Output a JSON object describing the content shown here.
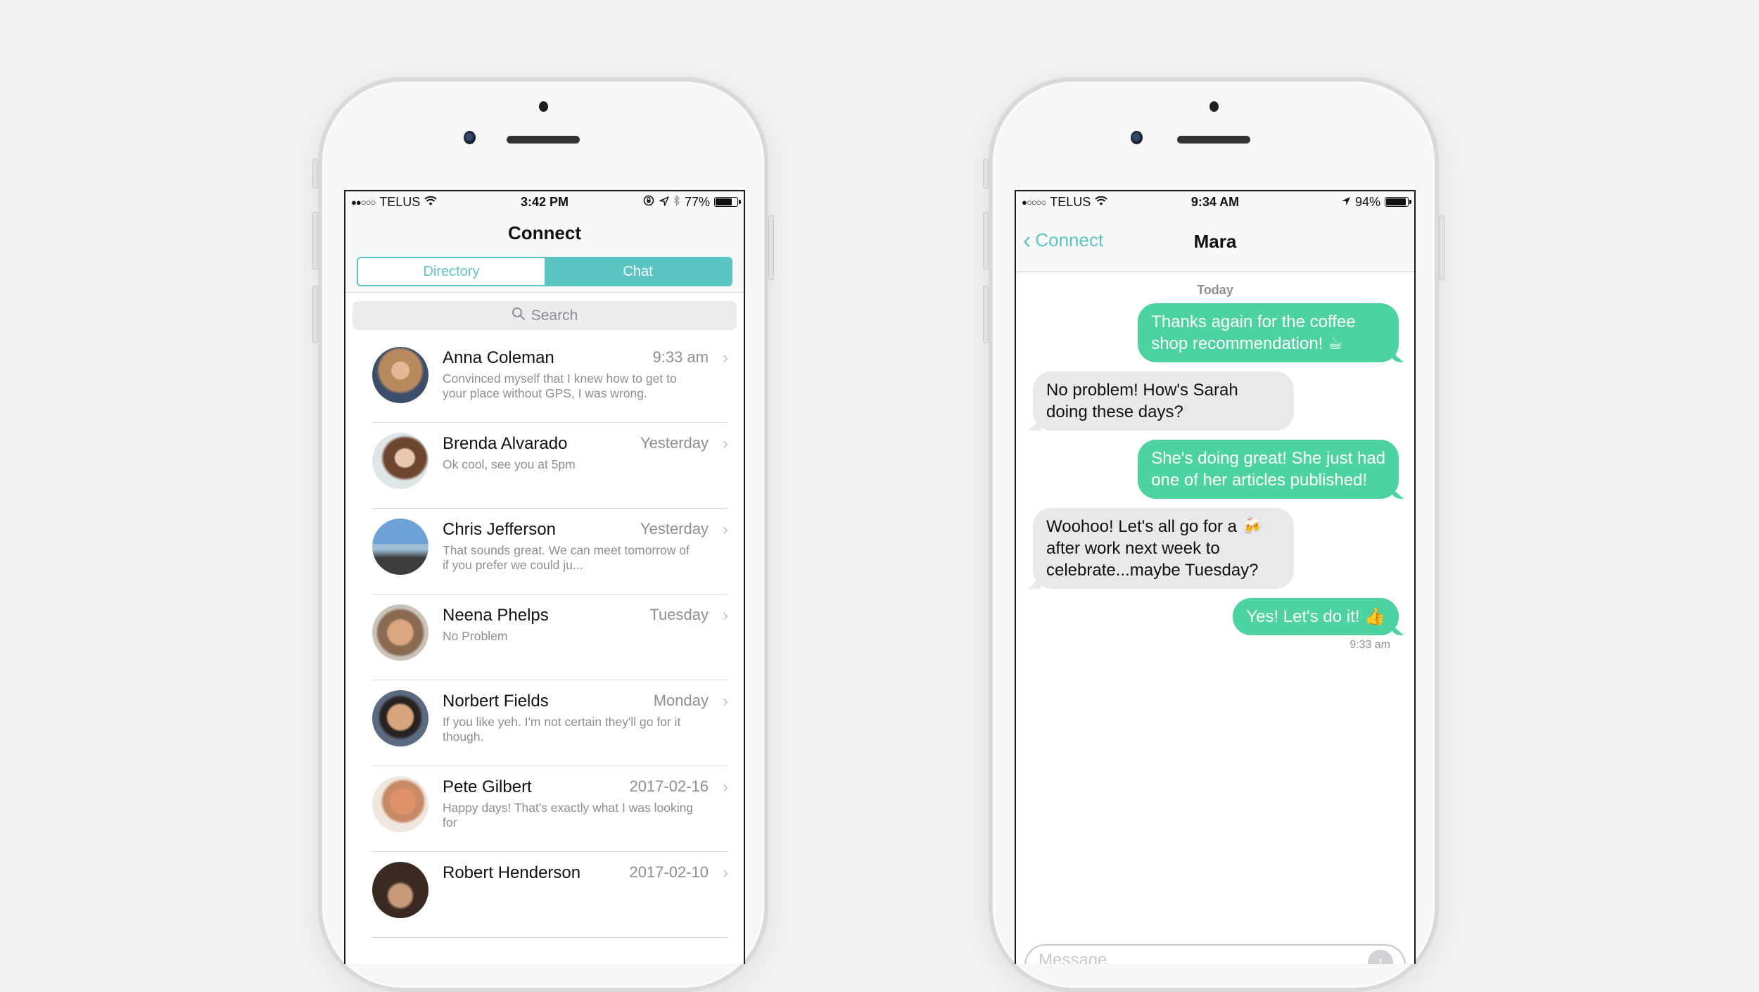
{
  "colors": {
    "accent": "#5bc5c3",
    "bubble_out": "#4cd3a0",
    "bubble_in": "#e9e9ec",
    "background": "#f2f2f2"
  },
  "left_phone": {
    "status_bar": {
      "signal": "●●○○○",
      "carrier": "TELUS",
      "wifi_icon": "wifi-icon",
      "time": "3:42 PM",
      "icons": [
        "orientation-lock-icon",
        "location-arrow-icon",
        "bluetooth-icon"
      ],
      "battery_percent": "77%",
      "battery_level": 0.77
    },
    "title": "Connect",
    "segments": [
      {
        "label": "Directory",
        "selected": false
      },
      {
        "label": "Chat",
        "selected": true
      }
    ],
    "search": {
      "placeholder": "Search",
      "icon": "search-icon"
    },
    "chats": [
      {
        "name": "Anna Coleman",
        "time": "9:33 am",
        "preview": "Convinced myself that I knew how to get to your place without GPS, I was wrong."
      },
      {
        "name": "Brenda Alvarado",
        "time": "Yesterday",
        "preview": "Ok cool, see you at 5pm"
      },
      {
        "name": "Chris Jefferson",
        "time": "Yesterday",
        "preview": "That sounds great. We can meet tomorrow of if you prefer we could ju..."
      },
      {
        "name": "Neena Phelps",
        "time": "Tuesday",
        "preview": "No Problem"
      },
      {
        "name": "Norbert Fields",
        "time": "Monday",
        "preview": "If you like yeh. I'm not certain they'll go for it though."
      },
      {
        "name": "Pete Gilbert",
        "time": "2017-02-16",
        "preview": "Happy days! That's exactly what I was looking for"
      },
      {
        "name": "Robert Henderson",
        "time": "2017-02-10",
        "preview": ""
      }
    ],
    "chevron": "›"
  },
  "right_phone": {
    "status_bar": {
      "signal": "●○○○○",
      "carrier": "TELUS",
      "wifi_icon": "wifi-icon",
      "time": "9:34 AM",
      "icons": [
        "location-arrow-icon"
      ],
      "battery_percent": "94%",
      "battery_level": 0.94
    },
    "back_label": "Connect",
    "back_chevron": "‹",
    "title": "Mara",
    "date_separator": "Today",
    "messages": [
      {
        "direction": "out",
        "text": "Thanks again for the coffee shop recommendation! ☕"
      },
      {
        "direction": "in",
        "text": "No problem! How's Sarah doing these days?"
      },
      {
        "direction": "out",
        "text": "She's doing great! She just had one of her articles published!"
      },
      {
        "direction": "in",
        "text": "Woohoo! Let's all go for a 🍻 after work next week to celebrate...maybe Tuesday?"
      },
      {
        "direction": "out",
        "text": "Yes! Let's do it! 👍"
      }
    ],
    "last_message_time": "9:33 am",
    "composer": {
      "placeholder": "Message",
      "value": "",
      "send_icon": "↑"
    }
  }
}
